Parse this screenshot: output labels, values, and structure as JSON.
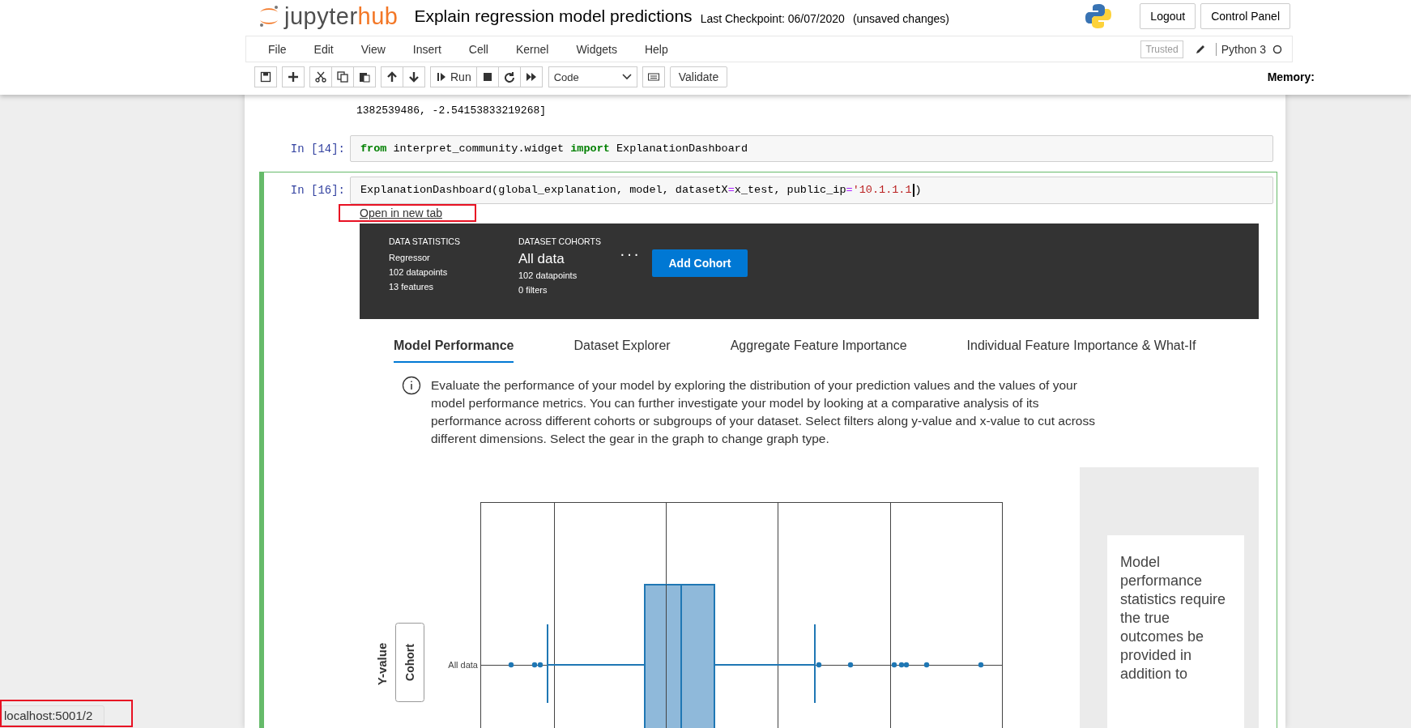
{
  "header": {
    "logo": {
      "main": "jupyter",
      "accent": "hub"
    },
    "notebook_title": "Explain regression model predictions",
    "checkpoint": "Last Checkpoint: 06/07/2020",
    "save_status": "(unsaved changes)",
    "buttons": [
      "Logout",
      "Control Panel"
    ]
  },
  "menu": {
    "items": [
      "File",
      "Edit",
      "View",
      "Insert",
      "Cell",
      "Kernel",
      "Widgets",
      "Help"
    ],
    "trusted": "Trusted",
    "kernel_name": "Python 3"
  },
  "toolbar": {
    "groups": [
      [
        {
          "kind": "save"
        }
      ],
      [
        {
          "kind": "plus"
        }
      ],
      [
        {
          "kind": "cut"
        },
        {
          "kind": "copy"
        },
        {
          "kind": "paste"
        }
      ],
      [
        {
          "kind": "up"
        },
        {
          "kind": "down"
        }
      ],
      [
        {
          "kind": "run",
          "label": "Run"
        },
        {
          "kind": "stop"
        },
        {
          "kind": "restart"
        },
        {
          "kind": "forward"
        }
      ],
      [
        {
          "kind": "select",
          "label": "Code"
        }
      ],
      [
        {
          "kind": "keyboard"
        }
      ],
      [
        {
          "kind": "text",
          "label": "Validate"
        }
      ]
    ],
    "memory": "Memory:"
  },
  "output_line": "1382539486, -2.54153833219268]",
  "cells": [
    {
      "prompt": "In [14]:",
      "selected": false,
      "tokens": [
        {
          "kind": "keyword",
          "text": "from"
        },
        {
          "kind": "plain",
          "text": " interpret_community.widget "
        },
        {
          "kind": "keyword",
          "text": "import"
        },
        {
          "kind": "plain",
          "text": " ExplanationDashboard"
        }
      ]
    },
    {
      "prompt": "In [16]:",
      "selected": true,
      "tokens": [
        {
          "kind": "plain",
          "text": "ExplanationDashboard(global_explanation, model, datasetX"
        },
        {
          "kind": "operator",
          "text": "="
        },
        {
          "kind": "plain",
          "text": "x_test, public_ip"
        },
        {
          "kind": "operator",
          "text": "="
        },
        {
          "kind": "string",
          "text": "'10.1.1.1"
        },
        {
          "kind": "cursor"
        },
        {
          "kind": "plain",
          "text": ")"
        }
      ]
    }
  ],
  "dashboard": {
    "link": "Open in new tab",
    "statistics": {
      "heading": "DATA STATISTICS",
      "lines": [
        "Regressor",
        "102 datapoints",
        "13 features"
      ]
    },
    "cohorts": {
      "heading": "DATASET COHORTS",
      "name": "All data",
      "lines": [
        "102 datapoints",
        "0 filters"
      ],
      "more": "···"
    },
    "add_button": "Add Cohort",
    "tabs": [
      {
        "label": "Model Performance",
        "selected": true
      },
      {
        "label": "Dataset Explorer",
        "selected": false
      },
      {
        "label": "Aggregate Feature Importance",
        "selected": false
      },
      {
        "label": "Individual Feature Importance & What-If",
        "selected": false
      }
    ],
    "info": "Evaluate the performance of your model by exploring the distribution of your prediction values and the values of your model performance metrics. You can further investigate your model by looking at a comparative analysis of its performance across different cohorts or subgroups of your dataset. Select filters along y-value and x-value to cut across different dimensions. Select the gear in the graph to change graph type.",
    "chart": {
      "y_title": "Y-value",
      "y_button": "Cohort",
      "category": "All data"
    },
    "side_message": "Model performance statistics require the true outcomes be provided in addition to"
  },
  "status_bar": "localhost:5001/2"
}
